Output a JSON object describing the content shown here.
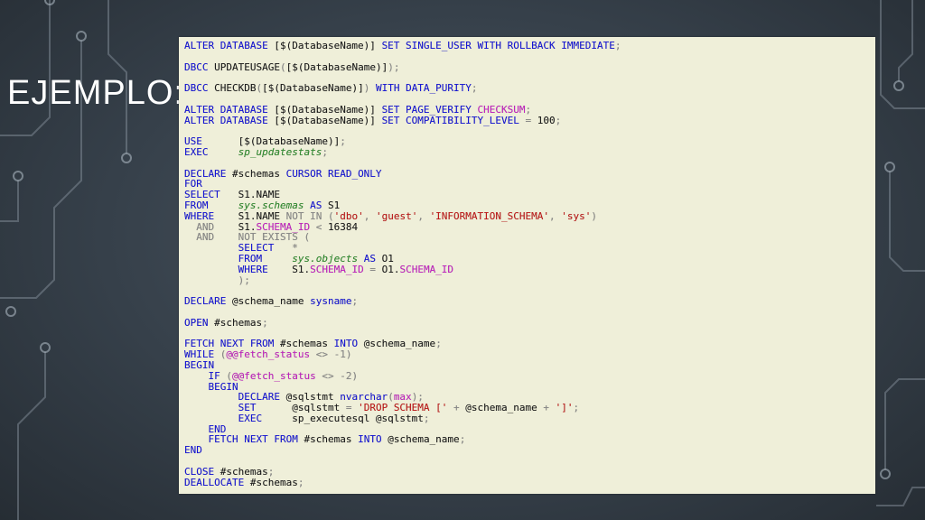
{
  "slide": {
    "title": "EJEMPLO:"
  },
  "code": {
    "lines": [
      [
        [
          "kw",
          "ALTER DATABASE "
        ],
        [
          "id",
          "[$(DatabaseName)] "
        ],
        [
          "kw",
          "SET SINGLE_USER WITH ROLLBACK IMMEDIATE"
        ],
        [
          "op",
          ";"
        ]
      ],
      [],
      [
        [
          "kw",
          "DBCC "
        ],
        [
          "id",
          "UPDATEUSAGE"
        ],
        [
          "op",
          "("
        ],
        [
          "id",
          "[$(DatabaseName)]"
        ],
        [
          "op",
          ");"
        ]
      ],
      [],
      [
        [
          "kw",
          "DBCC "
        ],
        [
          "id",
          "CHECKDB"
        ],
        [
          "op",
          "("
        ],
        [
          "id",
          "[$(DatabaseName)]"
        ],
        [
          "op",
          ") "
        ],
        [
          "kw",
          "WITH DATA_PURITY"
        ],
        [
          "op",
          ";"
        ]
      ],
      [],
      [
        [
          "kw",
          "ALTER DATABASE "
        ],
        [
          "id",
          "[$(DatabaseName)] "
        ],
        [
          "kw",
          "SET PAGE_VERIFY "
        ],
        [
          "fn",
          "CHECKSUM"
        ],
        [
          "op",
          ";"
        ]
      ],
      [
        [
          "kw",
          "ALTER DATABASE "
        ],
        [
          "id",
          "[$(DatabaseName)] "
        ],
        [
          "kw",
          "SET COMPATIBILITY_LEVEL "
        ],
        [
          "op",
          "= "
        ],
        [
          "id",
          "100"
        ],
        [
          "op",
          ";"
        ]
      ],
      [],
      [
        [
          "kw",
          "USE      "
        ],
        [
          "id",
          "[$(DatabaseName)]"
        ],
        [
          "op",
          ";"
        ]
      ],
      [
        [
          "kw",
          "EXEC     "
        ],
        [
          "cm",
          "sp_updatestats"
        ],
        [
          "op",
          ";"
        ]
      ],
      [],
      [
        [
          "kw",
          "DECLARE "
        ],
        [
          "id",
          "#schemas "
        ],
        [
          "kw",
          "CURSOR READ_ONLY"
        ]
      ],
      [
        [
          "kw",
          "FOR"
        ]
      ],
      [
        [
          "kw",
          "SELECT   "
        ],
        [
          "id",
          "S1.NAME"
        ]
      ],
      [
        [
          "kw",
          "FROM     "
        ],
        [
          "cm",
          "sys.schemas "
        ],
        [
          "kw",
          "AS "
        ],
        [
          "id",
          "S1"
        ]
      ],
      [
        [
          "kw",
          "WHERE    "
        ],
        [
          "id",
          "S1.NAME "
        ],
        [
          "op",
          "NOT IN ("
        ],
        [
          "str",
          "'dbo'"
        ],
        [
          "op",
          ", "
        ],
        [
          "str",
          "'guest'"
        ],
        [
          "op",
          ", "
        ],
        [
          "str",
          "'INFORMATION_SCHEMA'"
        ],
        [
          "op",
          ", "
        ],
        [
          "str",
          "'sys'"
        ],
        [
          "op",
          ")"
        ]
      ],
      [
        [
          "op",
          "  AND    "
        ],
        [
          "id",
          "S1."
        ],
        [
          "fn",
          "SCHEMA_ID "
        ],
        [
          "op",
          "< "
        ],
        [
          "id",
          "16384"
        ]
      ],
      [
        [
          "op",
          "  AND    NOT EXISTS ("
        ]
      ],
      [
        [
          "id",
          "         "
        ],
        [
          "kw",
          "SELECT   "
        ],
        [
          "op",
          "*"
        ]
      ],
      [
        [
          "id",
          "         "
        ],
        [
          "kw",
          "FROM     "
        ],
        [
          "cm",
          "sys.objects "
        ],
        [
          "kw",
          "AS "
        ],
        [
          "id",
          "O1"
        ]
      ],
      [
        [
          "id",
          "         "
        ],
        [
          "kw",
          "WHERE    "
        ],
        [
          "id",
          "S1."
        ],
        [
          "fn",
          "SCHEMA_ID "
        ],
        [
          "op",
          "= "
        ],
        [
          "id",
          "O1."
        ],
        [
          "fn",
          "SCHEMA_ID"
        ]
      ],
      [
        [
          "op",
          "         );"
        ]
      ],
      [],
      [
        [
          "kw",
          "DECLARE "
        ],
        [
          "id",
          "@schema_name "
        ],
        [
          "kw",
          "sysname"
        ],
        [
          "op",
          ";"
        ]
      ],
      [],
      [
        [
          "kw",
          "OPEN "
        ],
        [
          "id",
          "#schemas"
        ],
        [
          "op",
          ";"
        ]
      ],
      [],
      [
        [
          "kw",
          "FETCH NEXT FROM "
        ],
        [
          "id",
          "#schemas "
        ],
        [
          "kw",
          "INTO "
        ],
        [
          "id",
          "@schema_name"
        ],
        [
          "op",
          ";"
        ]
      ],
      [
        [
          "kw",
          "WHILE "
        ],
        [
          "op",
          "("
        ],
        [
          "fn",
          "@@fetch_status "
        ],
        [
          "op",
          "<> -1)"
        ]
      ],
      [
        [
          "kw",
          "BEGIN"
        ]
      ],
      [
        [
          "id",
          "    "
        ],
        [
          "kw",
          "IF "
        ],
        [
          "op",
          "("
        ],
        [
          "fn",
          "@@fetch_status "
        ],
        [
          "op",
          "<> -2)"
        ]
      ],
      [
        [
          "id",
          "    "
        ],
        [
          "kw",
          "BEGIN"
        ]
      ],
      [
        [
          "id",
          "         "
        ],
        [
          "kw",
          "DECLARE "
        ],
        [
          "id",
          "@sqlstmt "
        ],
        [
          "kw",
          "nvarchar"
        ],
        [
          "op",
          "("
        ],
        [
          "fn",
          "max"
        ],
        [
          "op",
          ");"
        ]
      ],
      [
        [
          "id",
          "         "
        ],
        [
          "kw",
          "SET      "
        ],
        [
          "id",
          "@sqlstmt "
        ],
        [
          "op",
          "= "
        ],
        [
          "str",
          "'DROP SCHEMA ['"
        ],
        [
          "op",
          " + "
        ],
        [
          "id",
          "@schema_name"
        ],
        [
          "op",
          " + "
        ],
        [
          "str",
          "']'"
        ],
        [
          "op",
          ";"
        ]
      ],
      [
        [
          "id",
          "         "
        ],
        [
          "kw",
          "EXEC     "
        ],
        [
          "id",
          "sp_executesql @sqlstmt"
        ],
        [
          "op",
          ";"
        ]
      ],
      [
        [
          "id",
          "    "
        ],
        [
          "kw",
          "END"
        ]
      ],
      [
        [
          "id",
          "    "
        ],
        [
          "kw",
          "FETCH NEXT FROM "
        ],
        [
          "id",
          "#schemas "
        ],
        [
          "kw",
          "INTO "
        ],
        [
          "id",
          "@schema_name"
        ],
        [
          "op",
          ";"
        ]
      ],
      [
        [
          "kw",
          "END"
        ]
      ],
      [],
      [
        [
          "kw",
          "CLOSE "
        ],
        [
          "id",
          "#schemas"
        ],
        [
          "op",
          ";"
        ]
      ],
      [
        [
          "kw",
          "DEALLOCATE "
        ],
        [
          "id",
          "#schemas"
        ],
        [
          "op",
          ";"
        ]
      ]
    ]
  }
}
